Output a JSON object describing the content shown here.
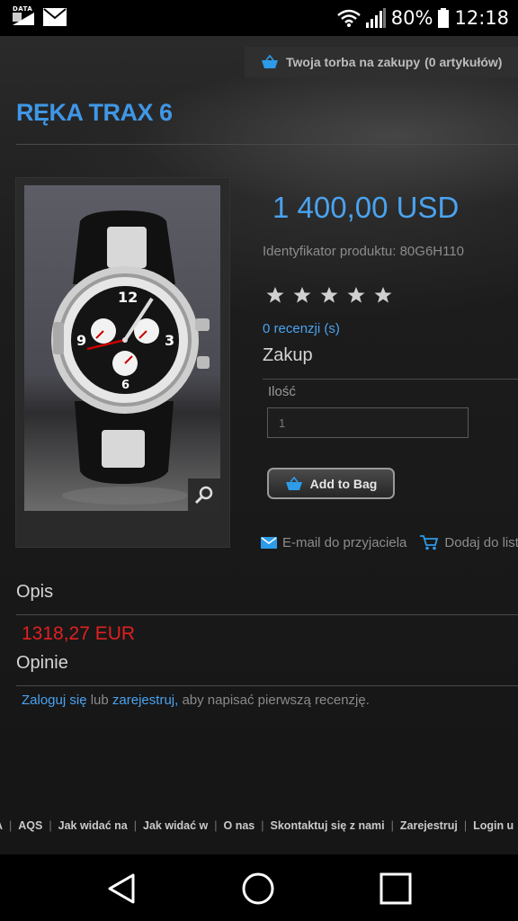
{
  "status_bar": {
    "data_label": "DATA",
    "battery": "80%",
    "time": "12:18"
  },
  "cart": {
    "label": "Twoja torba na zakupy",
    "count": "(0 artykułów)"
  },
  "product": {
    "title": "RĘKA TRAX 6",
    "price": "1 400,00 USD",
    "sku": "Identyfikator produktu: 80G6H110",
    "rating_stars": 5,
    "reviews": "0 recenzji (s)",
    "purchase_heading": "Zakup",
    "quantity_label": "Ilość",
    "quantity_value": "1",
    "add_button": "Add to Bag",
    "email_friend": "E-mail do przyjaciela",
    "add_to_list": "Dodaj do listy"
  },
  "description": {
    "heading": "Opis",
    "price_eur": "1318,27 EUR"
  },
  "opinions": {
    "heading": "Opinie",
    "login": "Zaloguj się",
    "or": "lub",
    "register": "zarejestruj,",
    "rest": "aby napisać pierwszą recenzję."
  },
  "footer_links": [
    "A",
    "AQS",
    "Jak widać na",
    "Jak widać w",
    "O nas",
    "Skontaktuj się z nami",
    "Zarejestruj",
    "Login u"
  ],
  "colors": {
    "accent": "#4aa3ef",
    "eur": "#e02020"
  },
  "nav_icons": [
    "back-icon",
    "home-icon",
    "recents-icon"
  ]
}
